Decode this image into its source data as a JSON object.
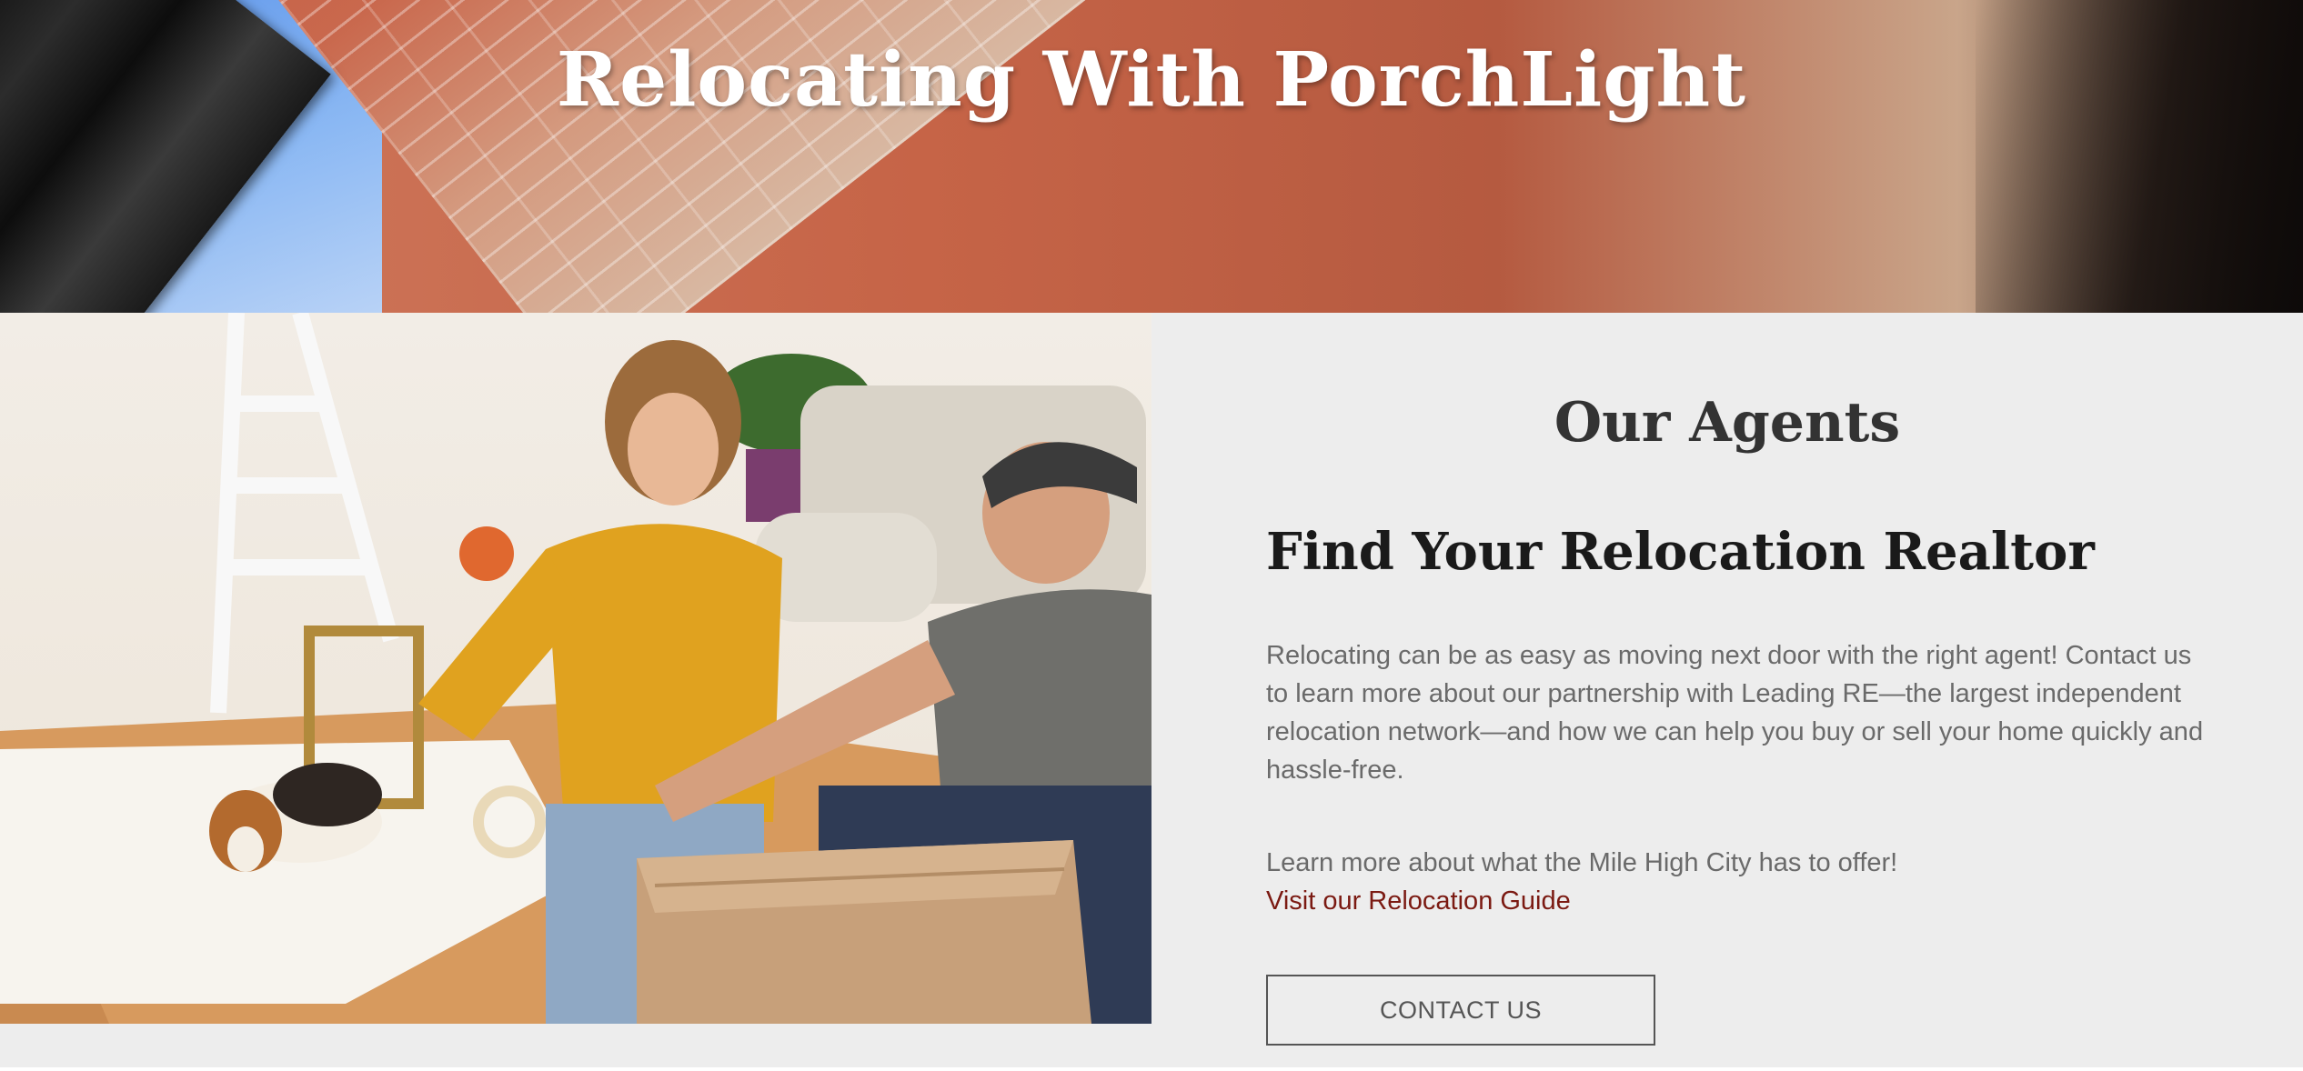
{
  "hero": {
    "title": "Relocating With PorchLight"
  },
  "photo": {
    "alt": "Couple taping a moving box with a beagle nearby"
  },
  "agents": {
    "heading": "Our Agents",
    "subheading": "Find Your Relocation Realtor",
    "body": "Relocating can be as easy as moving next door with the right agent! Contact us to learn more about our partnership with Leading RE—the largest independent relocation network—and how we can help you buy or sell your home quickly and hassle-free.",
    "learn_more": "Learn more about what the Mile High City has to offer!",
    "guide_link": "Visit our Relocation Guide",
    "contact_button": "CONTACT US"
  },
  "colors": {
    "panel_bg": "#ededed",
    "link": "#7b1a12",
    "heading": "#333333",
    "body_text": "#6a6a6a"
  }
}
